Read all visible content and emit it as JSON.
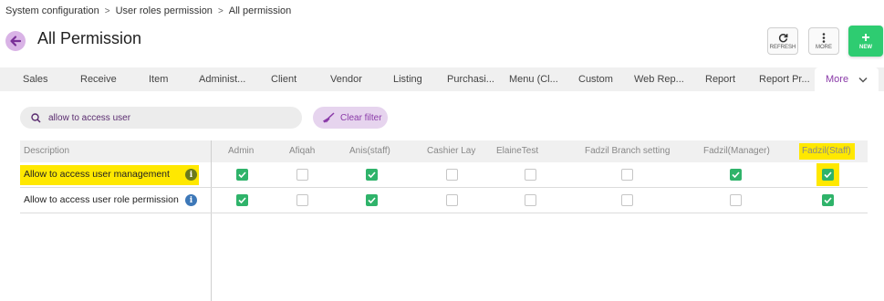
{
  "breadcrumb": {
    "items": [
      "System configuration",
      "User roles permission",
      "All permission"
    ],
    "separator": ">"
  },
  "page": {
    "title": "All Permission"
  },
  "toolbar": {
    "refresh_label": "REFRESH",
    "more_label": "MORE",
    "new_label": "NEW",
    "new_color": "#2ecc71"
  },
  "tabs": [
    "Sales",
    "Receive",
    "Item",
    "Administ...",
    "Client",
    "Vendor",
    "Listing",
    "Purchasi...",
    "Menu (Cl...",
    "Custom",
    "Web Rep...",
    "Report",
    "Report Pr...",
    "More"
  ],
  "search": {
    "value": "allow to access user",
    "clear_label": "Clear filter"
  },
  "table": {
    "description_header": "Description",
    "roles": [
      "Admin",
      "Afiqah",
      "Anis(staff)",
      "Cashier Lay",
      "ElaineTest",
      "Fadzil Branch setting",
      "Fadzil(Manager)",
      "Fadzil(Staff)"
    ],
    "rows": [
      {
        "description": "Allow to access user management",
        "info_icon": "info-icon",
        "checked": [
          true,
          false,
          true,
          false,
          false,
          false,
          true,
          true
        ]
      },
      {
        "description": "Allow to access user role permission",
        "info_icon": "info-icon",
        "checked": [
          true,
          false,
          true,
          false,
          false,
          false,
          false,
          true
        ]
      }
    ]
  },
  "colors": {
    "accent": "#8a3aa8",
    "check": "#2fb36a",
    "highlight": "#ffe800"
  }
}
